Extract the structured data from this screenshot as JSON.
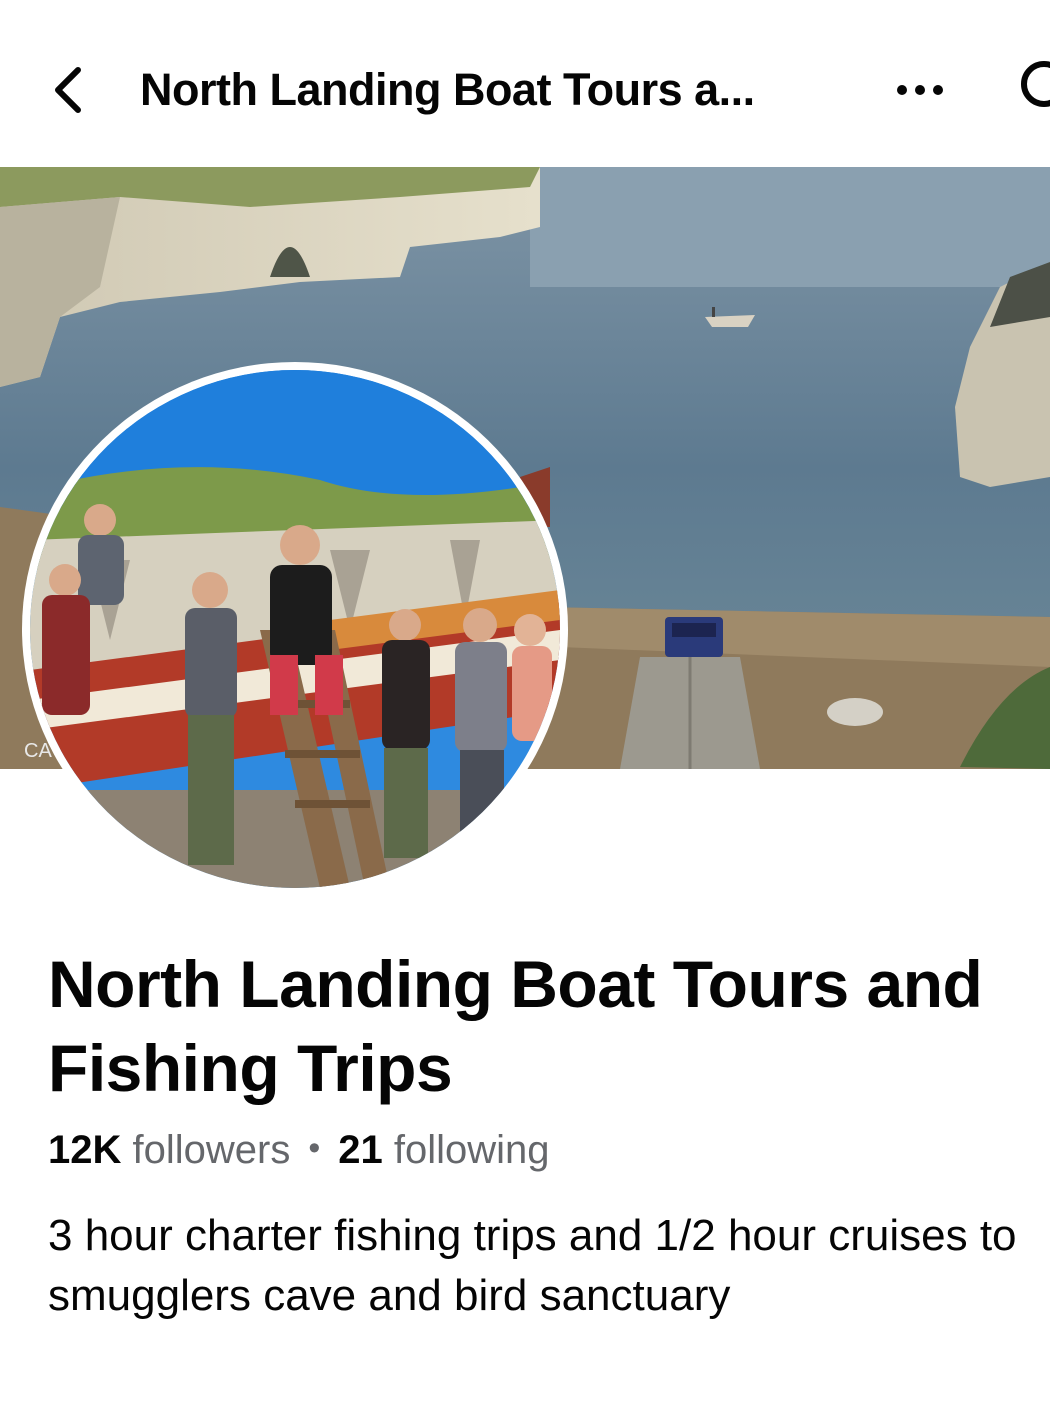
{
  "header": {
    "title": "North Landing Boat Tours a...",
    "back_icon": "chevron-left-icon",
    "more_icon": "more-horizontal-icon",
    "search_icon": "search-icon"
  },
  "cover": {
    "camera_label": "CA"
  },
  "page": {
    "name": "North Landing Boat Tours and Fishing Trips",
    "followers_count": "12K",
    "followers_label": "followers",
    "separator": "•",
    "following_count": "21",
    "following_label": "following",
    "bio": "3 hour charter fishing trips and 1/2 hour cruises to smugglers cave and bird sanctuary"
  },
  "colors": {
    "text_primary": "#050505",
    "text_secondary": "#65676b"
  }
}
